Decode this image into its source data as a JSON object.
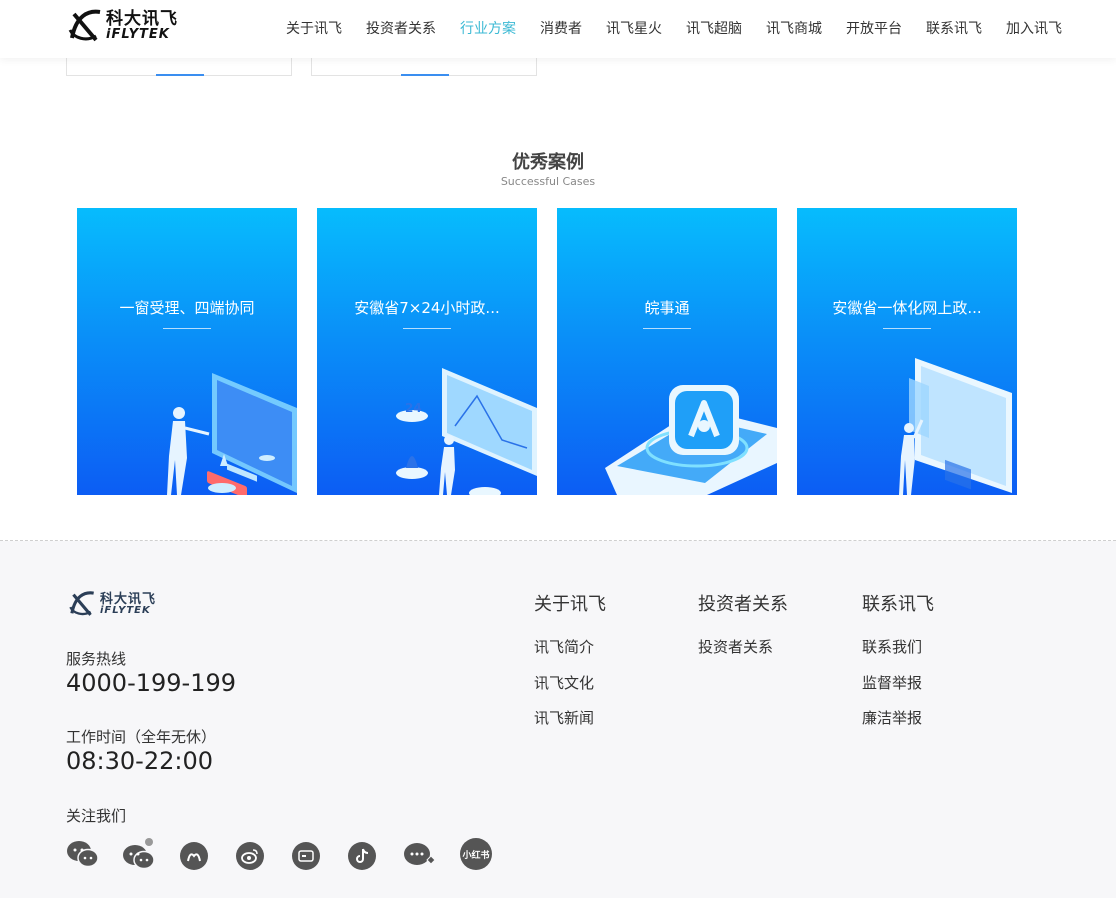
{
  "header": {
    "logo_cn": "科大讯飞",
    "logo_en": "iFLYTEK",
    "nav": [
      {
        "label": "关于讯飞",
        "active": false
      },
      {
        "label": "投资者关系",
        "active": false
      },
      {
        "label": "行业方案",
        "active": true
      },
      {
        "label": "消费者",
        "active": false
      },
      {
        "label": "讯飞星火",
        "active": false
      },
      {
        "label": "讯飞超脑",
        "active": false
      },
      {
        "label": "讯飞商城",
        "active": false
      },
      {
        "label": "开放平台",
        "active": false
      },
      {
        "label": "联系讯飞",
        "active": false
      },
      {
        "label": "加入讯飞",
        "active": false
      }
    ]
  },
  "cases_section": {
    "title": "优秀案例",
    "subtitle": "Successful Cases",
    "cases": [
      {
        "title": "一窗受理、四端协同",
        "illustration": "person-at-dashboard"
      },
      {
        "title": "安徽省7×24小时政...",
        "illustration": "chart-screen-with-pins"
      },
      {
        "title": "皖事通",
        "illustration": "app-icon-platform"
      },
      {
        "title": "安徽省一体化网上政...",
        "illustration": "person-at-monitor"
      }
    ]
  },
  "footer": {
    "logo_cn": "科大讯飞",
    "logo_en": "iFLYTEK",
    "hotline_label": "服务热线",
    "hotline": "4000-199-199",
    "hours_label": "工作时间（全年无休）",
    "hours": "08:30-22:00",
    "follow_label": "关注我们",
    "socials": [
      {
        "icon": "wechat-icon"
      },
      {
        "icon": "wechat-service-icon"
      },
      {
        "icon": "iflytek-app-icon"
      },
      {
        "icon": "weibo-icon"
      },
      {
        "icon": "video-icon"
      },
      {
        "icon": "tiktok-icon"
      },
      {
        "icon": "miniprogram-icon"
      },
      {
        "icon": "xiaohongshu-icon",
        "text": "小红书"
      }
    ],
    "columns": [
      {
        "heading": "关于讯飞",
        "links": [
          "讯飞简介",
          "讯飞文化",
          "讯飞新闻"
        ]
      },
      {
        "heading": "投资者关系",
        "links": [
          "投资者关系"
        ]
      },
      {
        "heading": "联系讯飞",
        "links": [
          "联系我们",
          "监督举报",
          "廉洁举报"
        ]
      }
    ]
  },
  "colors": {
    "accent": "#3bb9d4",
    "card_gradient_top": "#07bcfd",
    "card_gradient_bottom": "#0c5df4",
    "footer_bg": "#f7f7f9"
  }
}
